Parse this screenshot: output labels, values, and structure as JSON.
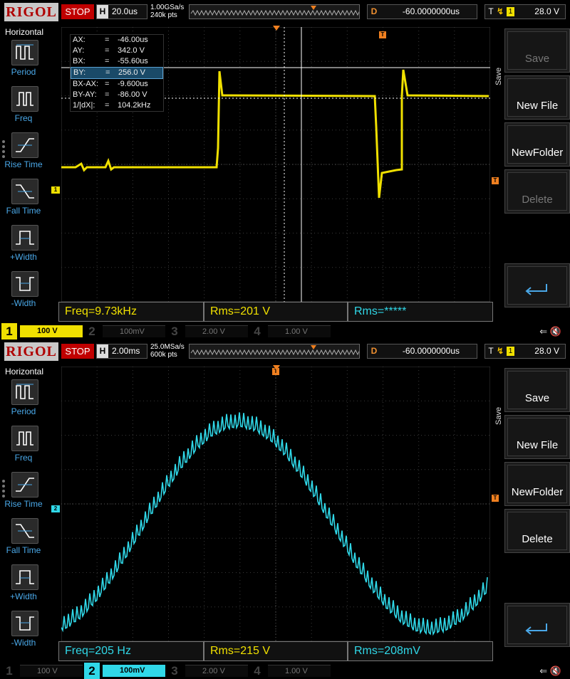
{
  "scope_panels": [
    {
      "logo": "RIGOL",
      "run_state": "STOP",
      "horizontal": {
        "label": "H",
        "timebase": "20.0us",
        "sample_rate": "1.00GSa/s",
        "memory_depth": "240k pts"
      },
      "delay": {
        "label": "D",
        "value": "-60.0000000us"
      },
      "trigger": {
        "label": "T",
        "edge": "rising-edge-icon",
        "source": "1",
        "level": "28.0 V"
      },
      "left_menu": {
        "title": "Horizontal",
        "items": [
          {
            "label": "Period",
            "icon": "period-icon"
          },
          {
            "label": "Freq",
            "icon": "freq-icon"
          },
          {
            "label": "Rise Time",
            "icon": "rise-time-icon"
          },
          {
            "label": "Fall Time",
            "icon": "fall-time-icon"
          },
          {
            "label": "+Width",
            "icon": "pos-width-icon"
          },
          {
            "label": "-Width",
            "icon": "neg-width-icon"
          }
        ]
      },
      "right_menu": {
        "tab": "Save",
        "buttons": [
          {
            "label": "Save",
            "enabled": false
          },
          {
            "label": "New File",
            "enabled": true
          },
          {
            "label": "NewFolder",
            "enabled": true
          },
          {
            "label": "Delete",
            "enabled": false
          }
        ],
        "enter_icon": "enter-icon"
      },
      "cursor_readout": {
        "visible": true,
        "rows": [
          {
            "label": "AX:",
            "eq": "=",
            "value": "-46.00us",
            "highlight": false
          },
          {
            "label": "AY:",
            "eq": "=",
            "value": "342.0 V",
            "highlight": false
          },
          {
            "label": "BX:",
            "eq": "=",
            "value": "-55.60us",
            "highlight": false
          },
          {
            "label": "BY:",
            "eq": "=",
            "value": "256.0 V",
            "highlight": true
          },
          {
            "label": "BX-AX:",
            "eq": "=",
            "value": "-9.600us",
            "highlight": false
          },
          {
            "label": "BY-AY:",
            "eq": "=",
            "value": "-86.00 V",
            "highlight": false
          },
          {
            "label": "1/|dX|:",
            "eq": "=",
            "value": "104.2kHz",
            "highlight": false
          }
        ]
      },
      "channel_marker": "1",
      "measurements": [
        {
          "text": "Freq=9.73kHz",
          "color": "#f0e000"
        },
        {
          "text": "Rms=201 V",
          "color": "#f0e000"
        },
        {
          "text": "Rms=*****",
          "color": "#30d8e8"
        }
      ],
      "channels": [
        {
          "num": "1",
          "scale": "100 V",
          "active": true,
          "color": "#f0e000"
        },
        {
          "num": "2",
          "scale": "100mV",
          "active": false,
          "color": "#30d8e8"
        },
        {
          "num": "3",
          "scale": "2.00 V",
          "active": false,
          "color": "#e040c0"
        },
        {
          "num": "4",
          "scale": "1.00 V",
          "active": false,
          "color": "#3070e0"
        }
      ],
      "trace_color": "#f0e000",
      "status_icons": "⇐ 🔇"
    },
    {
      "logo": "RIGOL",
      "run_state": "STOP",
      "horizontal": {
        "label": "H",
        "timebase": "2.00ms",
        "sample_rate": "25.0MSa/s",
        "memory_depth": "600k pts"
      },
      "delay": {
        "label": "D",
        "value": "-60.0000000us"
      },
      "trigger": {
        "label": "T",
        "edge": "rising-edge-icon",
        "source": "1",
        "level": "28.0 V"
      },
      "left_menu": {
        "title": "Horizontal",
        "items": [
          {
            "label": "Period",
            "icon": "period-icon"
          },
          {
            "label": "Freq",
            "icon": "freq-icon"
          },
          {
            "label": "Rise Time",
            "icon": "rise-time-icon"
          },
          {
            "label": "Fall Time",
            "icon": "fall-time-icon"
          },
          {
            "label": "+Width",
            "icon": "pos-width-icon"
          },
          {
            "label": "-Width",
            "icon": "neg-width-icon"
          }
        ]
      },
      "right_menu": {
        "tab": "Save",
        "buttons": [
          {
            "label": "Save",
            "enabled": true
          },
          {
            "label": "New File",
            "enabled": true
          },
          {
            "label": "NewFolder",
            "enabled": true
          },
          {
            "label": "Delete",
            "enabled": true
          }
        ],
        "enter_icon": "enter-icon"
      },
      "cursor_readout": {
        "visible": false,
        "rows": []
      },
      "channel_marker": "2",
      "measurements": [
        {
          "text": "Freq=205 Hz",
          "color": "#30d8e8"
        },
        {
          "text": "Rms=215 V",
          "color": "#f0e000"
        },
        {
          "text": "Rms=208mV",
          "color": "#30d8e8"
        }
      ],
      "channels": [
        {
          "num": "1",
          "scale": "100 V",
          "active": false,
          "color": "#f0e000"
        },
        {
          "num": "2",
          "scale": "100mV",
          "active": true,
          "color": "#30d8e8"
        },
        {
          "num": "3",
          "scale": "2.00 V",
          "active": false,
          "color": "#e040c0"
        },
        {
          "num": "4",
          "scale": "1.00 V",
          "active": false,
          "color": "#3070e0"
        }
      ],
      "trace_color": "#30d8e8",
      "status_icons": "⇐ 🔇"
    }
  ]
}
